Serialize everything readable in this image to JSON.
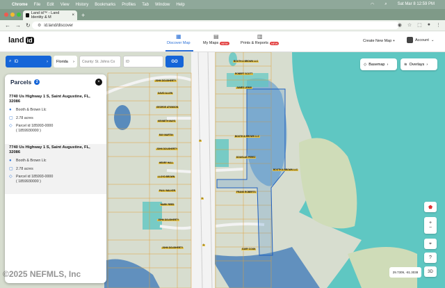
{
  "system_menu": {
    "app": "Chrome",
    "items": [
      "File",
      "Edit",
      "View",
      "History",
      "Bookmarks",
      "Profiles",
      "Tab",
      "Window",
      "Help"
    ],
    "clock": "Sat Mar 8  12:59 PM"
  },
  "browser": {
    "tab_title": "Land id™ - Land Identity & M",
    "url": "id.land/discover"
  },
  "app": {
    "logo_text": "land",
    "logo_box": "id",
    "tabs": [
      {
        "label": "Discover Map",
        "icon": "map-icon"
      },
      {
        "label": "My Maps",
        "icon": "folder-map-icon",
        "badge": "NEW"
      },
      {
        "label": "Prints & Reports",
        "icon": "printer-icon",
        "badge": "NEW"
      }
    ],
    "create_new_map": "Create New Map +",
    "account_label": "Account"
  },
  "search": {
    "mode_label": "ID",
    "state": "Florida",
    "county_placeholder": "County: St. Johns Co",
    "id_placeholder": "ID",
    "go_label": "GO"
  },
  "parcels_panel": {
    "title": "Parcels",
    "count": "2",
    "items": [
      {
        "address": "7740 Us Highway 1 S, Saint Augustine, FL, 32086",
        "owner": "Booth & Brown Llc",
        "acres": "2.78 acres",
        "parcel_label": "Parcel id 185993-0000",
        "parcel_alt": "( 1859930000 )"
      },
      {
        "address": "7740 Us Highway 1 S, Saint Augustine, FL, 32086",
        "owner": "Booth & Brown Llc",
        "acres": "2.78 acres",
        "parcel_label": "Parcel id 185993-0000",
        "parcel_alt": "( 1859930000 )"
      }
    ]
  },
  "map_controls": {
    "basemap": "Basemap",
    "overlays": "Overlays",
    "zoom_in": "+",
    "zoom_out": "−",
    "locate": "⌖",
    "help": "?",
    "three_d": "3D",
    "coordinates": "29.7309, -81.3038"
  },
  "watermark": "©2025 NEFMLS, Inc",
  "road_labels": [
    "1",
    "1",
    "1"
  ],
  "parcel_owner_labels": [
    "JOHN DOUGHERTY",
    "DAVID ALLEN",
    "GEORGE ATKINSON",
    "KENNETH MAYS",
    "RAY MARTIN",
    "JOHN DOUGHERTY",
    "HENRY HALL",
    "LLOYD BROWN",
    "PAUL WALKER",
    "MARK REED",
    "JOHN DOUGHERTY",
    "BOOTH & BROWN LLC",
    "ROBERT SCOTT",
    "JAMES LEWIS",
    "BOOTH & BROWN LLC",
    "DOUGLAS PEREZ",
    "FRANK ROBERTS",
    "BOOTH & BROWN LLC",
    "JOHN DOUGHERTY",
    "GARY COOK"
  ]
}
